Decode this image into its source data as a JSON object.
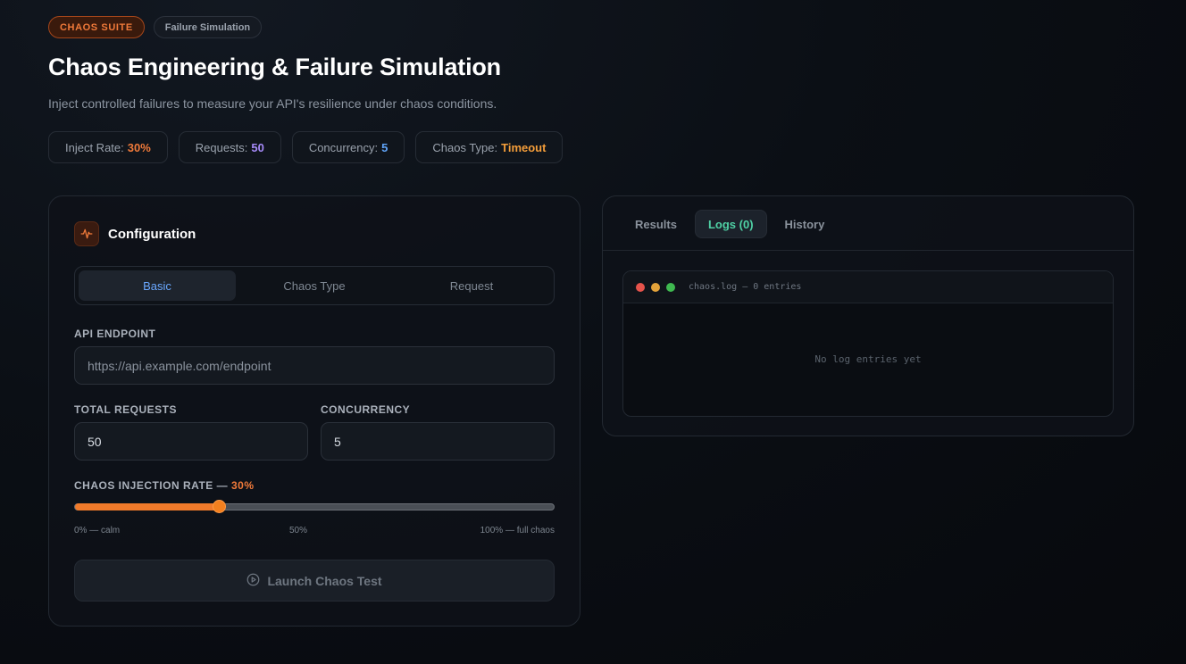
{
  "header": {
    "badge_suite": "CHAOS SUITE",
    "badge_section": "Failure Simulation",
    "title": "Chaos Engineering & Failure Simulation",
    "subtitle": "Inject controlled failures to measure your API's resilience under chaos conditions."
  },
  "stats": [
    {
      "label": "Inject Rate:",
      "value": "30%",
      "color": "#f07a3a"
    },
    {
      "label": "Requests:",
      "value": "50",
      "color": "#a78bfa"
    },
    {
      "label": "Concurrency:",
      "value": "5",
      "color": "#60a5fa"
    },
    {
      "label": "Chaos Type:",
      "value": "Timeout",
      "color": "#f59e3a"
    }
  ],
  "config": {
    "title": "Configuration",
    "icon": "activity-icon",
    "tabs": [
      {
        "label": "Basic",
        "active": true
      },
      {
        "label": "Chaos Type",
        "active": false
      },
      {
        "label": "Request",
        "active": false
      }
    ],
    "endpoint_label": "API ENDPOINT",
    "endpoint_placeholder": "https://api.example.com/endpoint",
    "total_requests_label": "TOTAL REQUESTS",
    "total_requests_value": "50",
    "concurrency_label": "CONCURRENCY",
    "concurrency_value": "5",
    "rate_label": "CHAOS INJECTION RATE —",
    "rate_value_text": "30%",
    "rate_fraction": 0.3,
    "rate_ticks": [
      "0% — calm",
      "50%",
      "100% — full chaos"
    ],
    "launch_label": "Launch Chaos Test",
    "launch_icon": "play-circle-icon"
  },
  "logs": {
    "tabs": [
      {
        "label": "Results",
        "active": false
      },
      {
        "label": "Logs (0)",
        "active": true
      },
      {
        "label": "History",
        "active": false
      }
    ],
    "terminal_title": "chaos.log — 0 entries",
    "empty_text": "No log entries yet",
    "dot_colors": [
      "#e5534b",
      "#e3a33a",
      "#3fb950"
    ]
  }
}
